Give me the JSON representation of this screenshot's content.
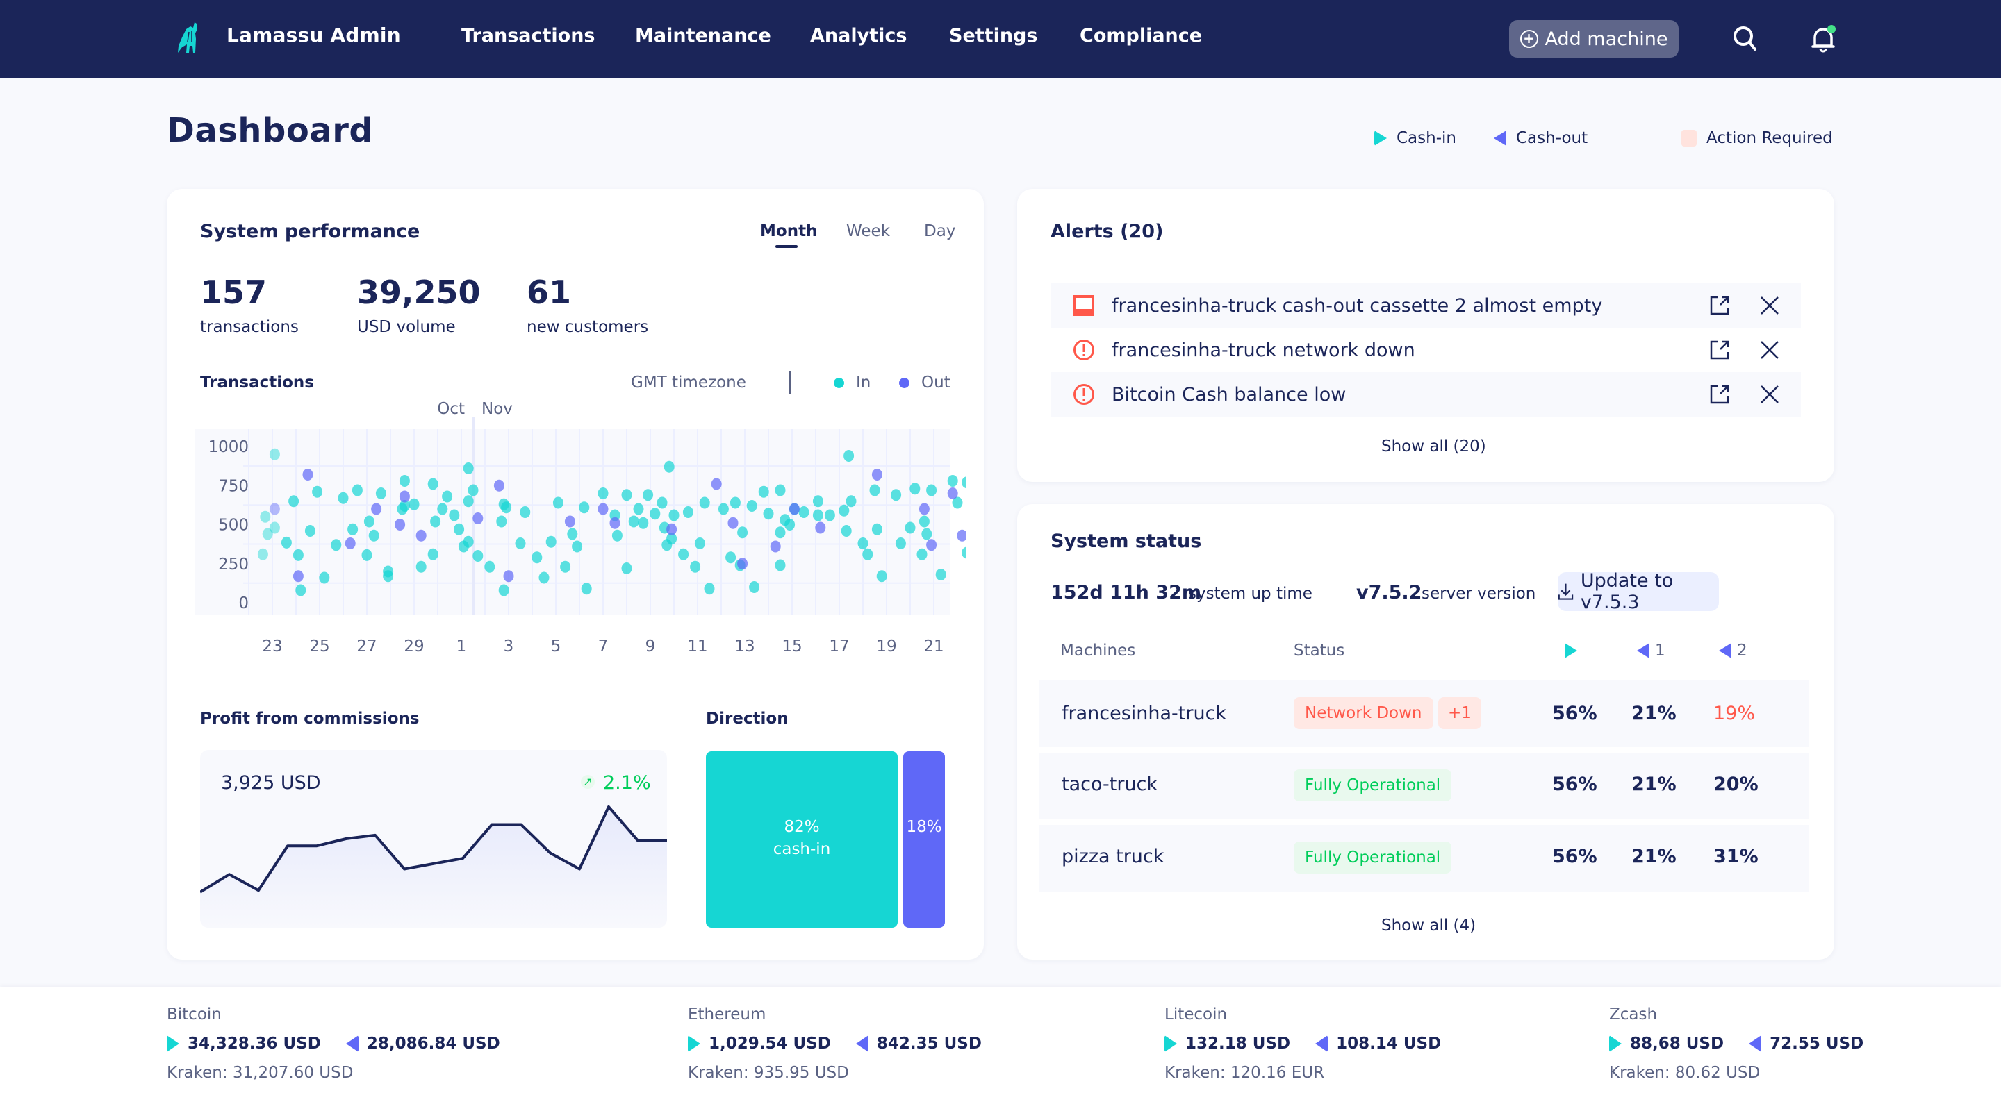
{
  "app": {
    "name": "Lamassu Admin"
  },
  "nav": {
    "items": [
      "Transactions",
      "Maintenance",
      "Analytics",
      "Settings",
      "Compliance"
    ],
    "add_machine": "Add machine"
  },
  "header": {
    "title": "Dashboard",
    "legend": {
      "cash_in": "Cash-in",
      "cash_out": "Cash-out",
      "action_required": "Action Required"
    }
  },
  "colors": {
    "cash_in": "#16d6d3",
    "cash_out": "#5f68f7",
    "navy": "#1b2559",
    "alert_red": "#ff584a",
    "ok_green": "#00cd5a"
  },
  "performance": {
    "title": "System performance",
    "tabs": [
      "Month",
      "Week",
      "Day"
    ],
    "active_tab": "Month",
    "kpis": [
      {
        "value": "157",
        "label": "transactions"
      },
      {
        "value": "39,250",
        "label": "USD volume"
      },
      {
        "value": "61",
        "label": "new customers"
      }
    ],
    "transactions_title": "Transactions",
    "timezone": "GMT timezone",
    "legend_in": "In",
    "legend_out": "Out",
    "month_labels": [
      "Oct",
      "Nov"
    ],
    "profit": {
      "title": "Profit from commissions",
      "value": "3,925 USD",
      "change": "2.1%"
    },
    "direction": {
      "title": "Direction",
      "in_pct": "82%",
      "in_label": "cash-in",
      "out_pct": "18%"
    }
  },
  "chart_data": [
    {
      "type": "scatter",
      "title": "Transactions",
      "xlabel": "",
      "ylabel": "",
      "ylim": [
        0,
        1000
      ],
      "y_ticks": [
        0,
        250,
        500,
        750,
        1000
      ],
      "x_ticks": [
        "23",
        "25",
        "27",
        "29",
        "1",
        "3",
        "5",
        "7",
        "9",
        "11",
        "13",
        "15",
        "17",
        "19",
        "21"
      ],
      "x_unit": "day offset from Oct 23 (0 = Oct 23, 9 = Nov 1)",
      "xlim": [
        -0.7,
        30.3
      ],
      "grid": true,
      "legend": "top-right",
      "series": [
        {
          "name": "In",
          "points": [
            [
              -0.4,
              310
            ],
            [
              -0.3,
              550
            ],
            [
              -0.2,
              440
            ],
            [
              0.1,
              480
            ],
            [
              0.1,
              950
            ],
            [
              0.6,
              385
            ],
            [
              0.9,
              650
            ],
            [
              1.1,
              305
            ],
            [
              1.2,
              80
            ],
            [
              1.6,
              460
            ],
            [
              1.9,
              710
            ],
            [
              2.2,
              160
            ],
            [
              2.7,
              370
            ],
            [
              3.0,
              670
            ],
            [
              3.4,
              470
            ],
            [
              3.6,
              720
            ],
            [
              4.0,
              305
            ],
            [
              4.1,
              520
            ],
            [
              4.3,
              430
            ],
            [
              4.6,
              700
            ],
            [
              4.9,
              200
            ],
            [
              4.9,
              170
            ],
            [
              5.5,
              600
            ],
            [
              5.6,
              780
            ],
            [
              5.6,
              620
            ],
            [
              6.0,
              630
            ],
            [
              6.3,
              230
            ],
            [
              6.8,
              310
            ],
            [
              6.8,
              760
            ],
            [
              6.9,
              520
            ],
            [
              7.2,
              600
            ],
            [
              7.4,
              680
            ],
            [
              7.7,
              560
            ],
            [
              7.9,
              470
            ],
            [
              8.1,
              360
            ],
            [
              8.3,
              650
            ],
            [
              8.3,
              390
            ],
            [
              8.3,
              860
            ],
            [
              8.5,
              720
            ],
            [
              8.7,
              300
            ],
            [
              9.2,
              230
            ],
            [
              9.7,
              520
            ],
            [
              9.8,
              630
            ],
            [
              9.8,
              80
            ],
            [
              9.9,
              610
            ],
            [
              10.5,
              380
            ],
            [
              10.7,
              580
            ],
            [
              11.2,
              290
            ],
            [
              11.5,
              160
            ],
            [
              11.8,
              390
            ],
            [
              12.1,
              640
            ],
            [
              12.4,
              230
            ],
            [
              12.7,
              440
            ],
            [
              12.9,
              360
            ],
            [
              13.2,
              610
            ],
            [
              13.3,
              90
            ],
            [
              14.0,
              700
            ],
            [
              14.5,
              560
            ],
            [
              14.6,
              430
            ],
            [
              15.0,
              690
            ],
            [
              15.0,
              220
            ],
            [
              15.3,
              520
            ],
            [
              15.5,
              600
            ],
            [
              15.7,
              510
            ],
            [
              15.9,
              690
            ],
            [
              16.2,
              570
            ],
            [
              16.5,
              640
            ],
            [
              16.6,
              480
            ],
            [
              16.7,
              370
            ],
            [
              16.8,
              870
            ],
            [
              16.9,
              410
            ],
            [
              17.0,
              560
            ],
            [
              17.4,
              310
            ],
            [
              17.6,
              580
            ],
            [
              17.9,
              230
            ],
            [
              18.1,
              380
            ],
            [
              18.3,
              640
            ],
            [
              18.5,
              90
            ],
            [
              19.1,
              600
            ],
            [
              19.4,
              290
            ],
            [
              19.6,
              640
            ],
            [
              19.8,
              240
            ],
            [
              19.9,
              450
            ],
            [
              20.3,
              620
            ],
            [
              20.4,
              100
            ],
            [
              20.8,
              710
            ],
            [
              21.0,
              570
            ],
            [
              21.5,
              720
            ],
            [
              21.5,
              240
            ],
            [
              21.5,
              450
            ],
            [
              21.7,
              530
            ],
            [
              21.9,
              500
            ],
            [
              22.1,
              600
            ],
            [
              22.5,
              580
            ],
            [
              23.1,
              650
            ],
            [
              23.1,
              560
            ],
            [
              23.6,
              560
            ],
            [
              24.2,
              590
            ],
            [
              24.3,
              460
            ],
            [
              24.4,
              940
            ],
            [
              24.5,
              650
            ],
            [
              25.0,
              380
            ],
            [
              25.2,
              310
            ],
            [
              25.5,
              720
            ],
            [
              25.6,
              470
            ],
            [
              25.8,
              170
            ],
            [
              26.4,
              690
            ],
            [
              26.6,
              380
            ],
            [
              27.0,
              480
            ],
            [
              27.2,
              730
            ],
            [
              27.5,
              310
            ],
            [
              27.6,
              520
            ],
            [
              27.7,
              440
            ],
            [
              27.9,
              720
            ],
            [
              28.3,
              180
            ],
            [
              28.8,
              780
            ],
            [
              29.0,
              640
            ],
            [
              29.4,
              320
            ],
            [
              29.4,
              770
            ],
            [
              29.6,
              710
            ],
            [
              29.7,
              520
            ],
            [
              29.9,
              600
            ],
            [
              30.0,
              630
            ],
            [
              30.2,
              670
            ]
          ]
        },
        {
          "name": "Out",
          "points": [
            [
              0.1,
              600
            ],
            [
              1.5,
              820
            ],
            [
              1.1,
              170
            ],
            [
              3.3,
              380
            ],
            [
              4.4,
              600
            ],
            [
              5.4,
              500
            ],
            [
              5.6,
              680
            ],
            [
              6.3,
              430
            ],
            [
              8.7,
              540
            ],
            [
              9.6,
              750
            ],
            [
              10.0,
              170
            ],
            [
              12.6,
              520
            ],
            [
              14.0,
              600
            ],
            [
              14.5,
              510
            ],
            [
              16.9,
              470
            ],
            [
              18.8,
              760
            ],
            [
              19.5,
              510
            ],
            [
              19.9,
              250
            ],
            [
              21.3,
              360
            ],
            [
              22.1,
              600
            ],
            [
              23.2,
              480
            ],
            [
              25.6,
              820
            ],
            [
              27.6,
              600
            ],
            [
              28.8,
              700
            ],
            [
              29.2,
              430
            ],
            [
              30.1,
              550
            ],
            [
              27.9,
              370
            ]
          ]
        }
      ]
    },
    {
      "type": "area",
      "title": "Profit from commissions",
      "x": [
        0,
        1,
        2,
        3,
        4,
        5,
        6,
        7,
        8,
        9,
        10,
        11,
        12,
        13,
        14,
        15,
        16
      ],
      "values": [
        0.2,
        0.3,
        0.21,
        0.46,
        0.46,
        0.5,
        0.52,
        0.33,
        0.36,
        0.39,
        0.58,
        0.58,
        0.42,
        0.33,
        0.68,
        0.49,
        0.49
      ],
      "ylim": [
        0,
        1
      ],
      "xlabel": "",
      "ylabel": ""
    },
    {
      "type": "bar",
      "title": "Direction",
      "categories": [
        "cash-in",
        "cash-out"
      ],
      "values": [
        82,
        18
      ],
      "ylim": [
        0,
        100
      ]
    }
  ],
  "alerts": {
    "title": "Alerts (20)",
    "items": [
      {
        "icon": "cassette-icon",
        "text": "francesinha-truck cash-out cassette 2 almost empty"
      },
      {
        "icon": "warning-icon",
        "text": "francesinha-truck network down"
      },
      {
        "icon": "warning-icon",
        "text": "Bitcoin Cash balance low"
      }
    ],
    "show_all": "Show all (20)"
  },
  "system_status": {
    "title": "System status",
    "uptime_value": "152d 11h 32m",
    "uptime_label": "system up time",
    "version_value": "v7.5.2",
    "version_label": "server version",
    "update_button": "Update to v7.5.3",
    "columns": {
      "machines": "Machines",
      "status": "Status",
      "cassette1": "1",
      "cassette2": "2"
    },
    "rows": [
      {
        "machine": "francesinha-truck",
        "status": "Network Down",
        "status_type": "error",
        "extra": "+1",
        "cash_in": "56%",
        "c1": "21%",
        "c2": "19%",
        "c2_alert": true
      },
      {
        "machine": "taco-truck",
        "status": "Fully Operational",
        "status_type": "ok",
        "cash_in": "56%",
        "c1": "21%",
        "c2": "20%"
      },
      {
        "machine": "pizza truck",
        "status": "Fully Operational",
        "status_type": "ok",
        "cash_in": "56%",
        "c1": "21%",
        "c2": "31%"
      }
    ],
    "show_all": "Show all (4)"
  },
  "footer": {
    "coins": [
      {
        "name": "Bitcoin",
        "cash_in": "34,328.36 USD",
        "cash_out": "28,086.84 USD",
        "kraken": "Kraken: 31,207.60 USD"
      },
      {
        "name": "Ethereum",
        "cash_in": "1,029.54 USD",
        "cash_out": "842.35 USD",
        "kraken": "Kraken: 935.95 USD"
      },
      {
        "name": "Litecoin",
        "cash_in": "132.18 USD",
        "cash_out": "108.14 USD",
        "kraken": "Kraken: 120.16 EUR"
      },
      {
        "name": "Zcash",
        "cash_in": "88,68 USD",
        "cash_out": "72.55 USD",
        "kraken": "Kraken: 80.62 USD"
      }
    ]
  }
}
